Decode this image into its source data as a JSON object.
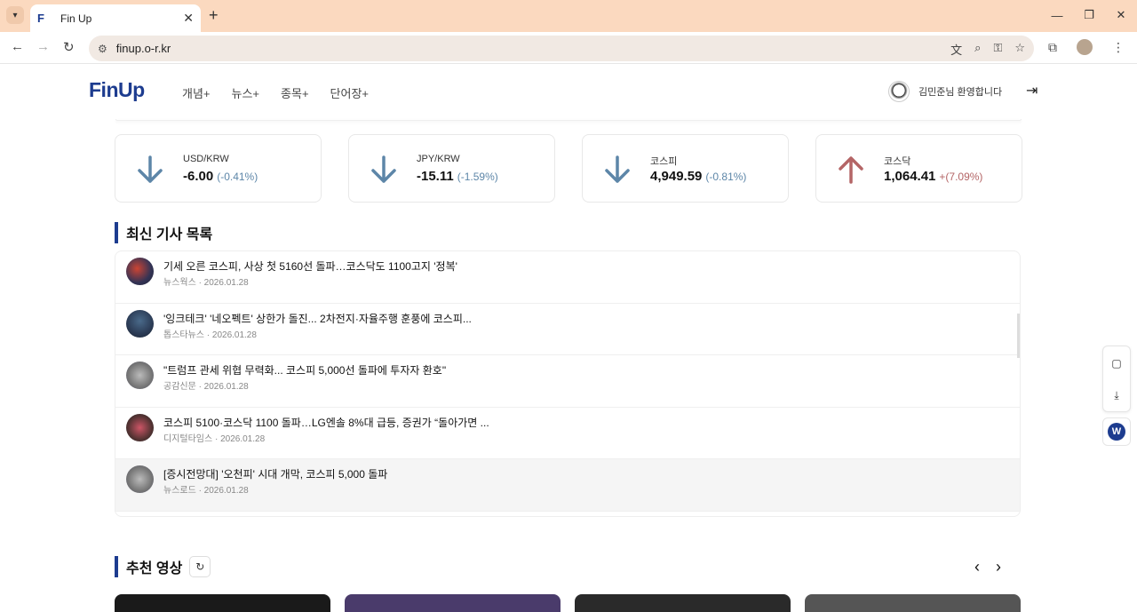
{
  "browser": {
    "tab_title": "Fin Up",
    "url": "finup.o-r.kr",
    "tab_close": "✕",
    "new_tab": "+",
    "controls": [
      "—",
      "❐",
      "✕"
    ]
  },
  "site": {
    "logo": "FinUp",
    "nav": [
      "개념+",
      "뉴스+",
      "종목+",
      "단어장+"
    ],
    "user_greeting": "김민준님 환영합니다"
  },
  "market": [
    {
      "name": "USD/KRW",
      "value": "-6.00",
      "change": "(-0.41%)",
      "direction": "down"
    },
    {
      "name": "JPY/KRW",
      "value": "-15.11",
      "change": "(-1.59%)",
      "direction": "down"
    },
    {
      "name": "코스피",
      "value": "4,949.59",
      "change": "(-0.81%)",
      "direction": "down"
    },
    {
      "name": "코스닥",
      "value": "1,064.41",
      "change": "+(7.09%)",
      "direction": "up"
    }
  ],
  "news_section": {
    "title": "최신 기사 목록",
    "items": [
      {
        "title": "기세 오른 코스피, 사상 첫 5160선 돌파…코스닥도 1100고지 '정복'",
        "meta": "뉴스웍스 · 2026.01.28"
      },
      {
        "title": "'잉크테크' '네오펙트' 상한가 돌진... 2차전지·자율주행 훈풍에 코스피...",
        "meta": "톱스타뉴스 · 2026.01.28"
      },
      {
        "title": "\"트럼프 관세 위협 무력화... 코스피 5,000선 돌파에 투자자 환호\"",
        "meta": "공감신문 · 2026.01.28"
      },
      {
        "title": "코스피 5100·코스닥 1100 돌파…LG엔솔 8%대 급등, 증권가 “돌아가면 ...",
        "meta": "디지털타임스 · 2026.01.28"
      },
      {
        "title": "[증시전망대] '오천피' 시대 개막, 코스피 5,000 돌파",
        "meta": "뉴스로드 · 2026.01.28"
      }
    ]
  },
  "video_section": {
    "title": "추천 영상"
  },
  "colors": {
    "brand": "#1d3c8f",
    "down": "#5d86a8",
    "up": "#b46566"
  }
}
